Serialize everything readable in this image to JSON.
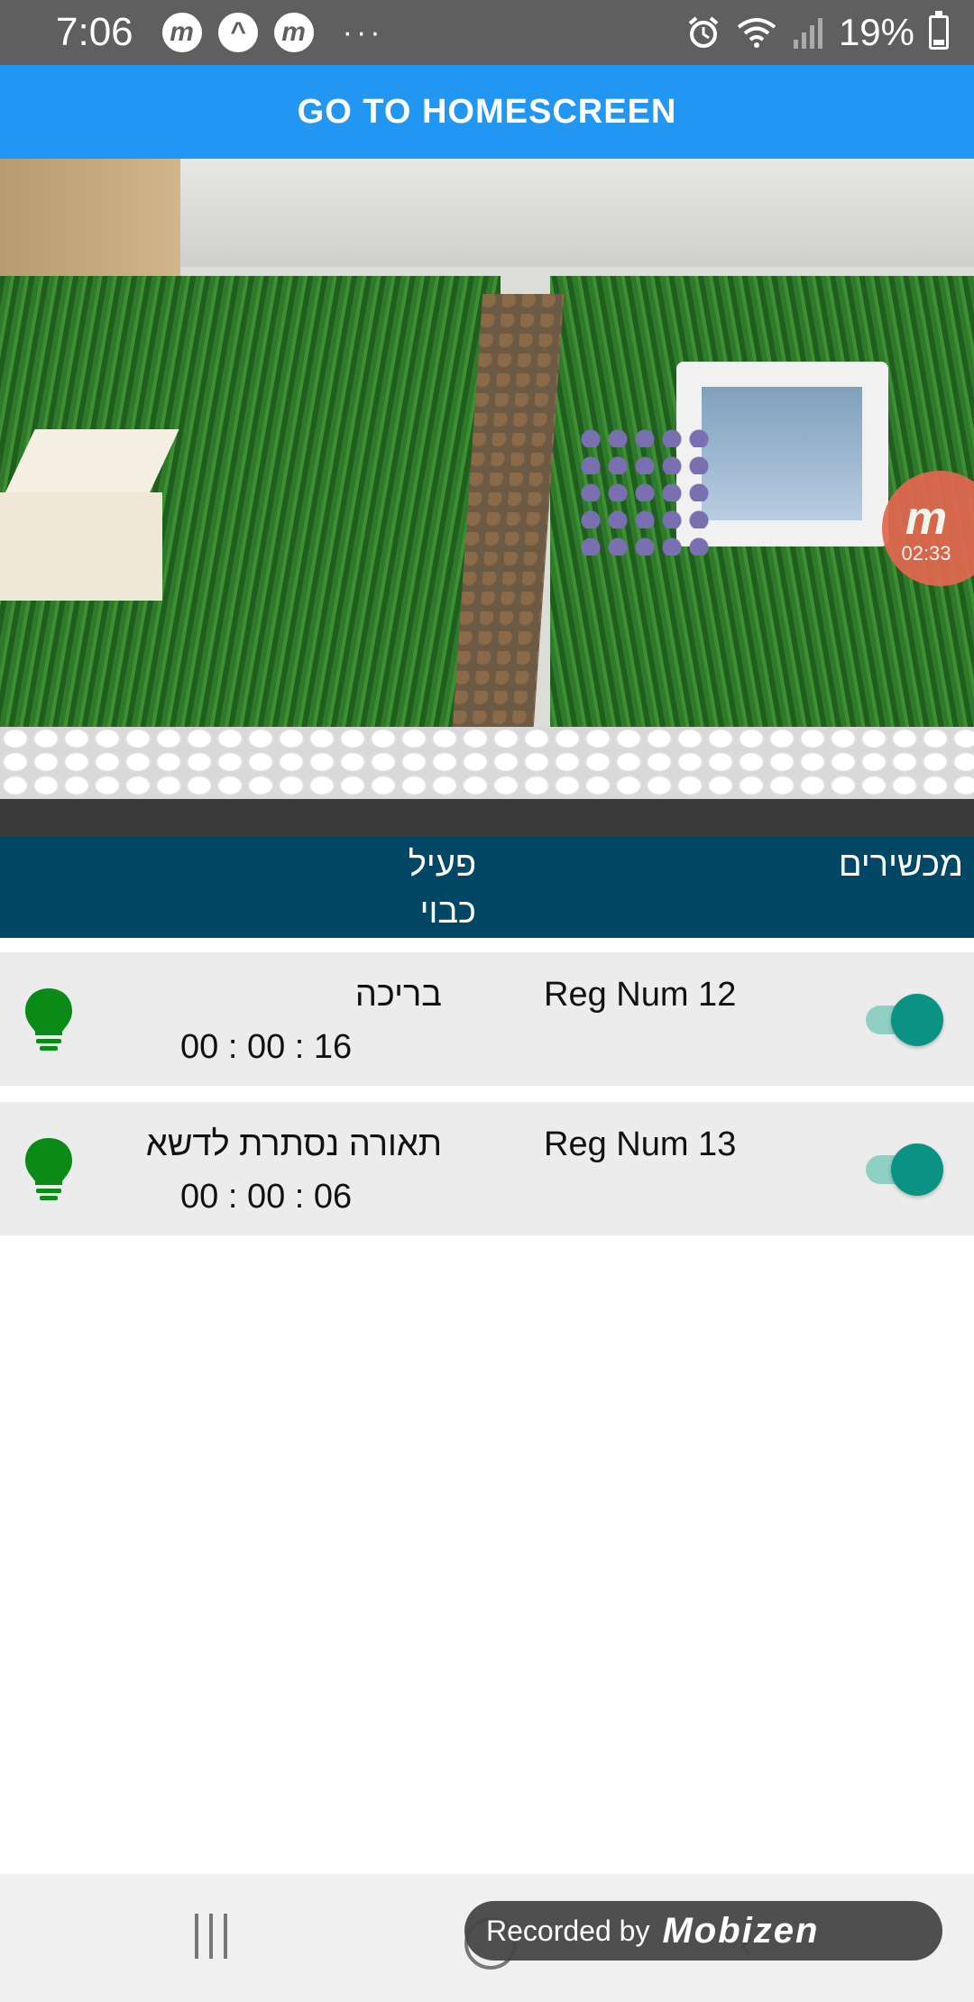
{
  "status_bar": {
    "time": "7:06",
    "badges": [
      "m",
      "^",
      "m"
    ],
    "overflow": "···",
    "battery": "19%",
    "icons": [
      "alarm-icon",
      "wifi-icon",
      "signal-icon",
      "battery-icon"
    ]
  },
  "header": {
    "button_label": "GO TO HOMESCREEN"
  },
  "camera": {
    "recorder_logo": "m",
    "recorder_time": "02:33"
  },
  "table_header": {
    "devices": "מכשירים",
    "active": "פעיל",
    "off": "כבוי"
  },
  "devices": [
    {
      "reg": "Reg Num 12",
      "name": "בריכה",
      "time": "00 : 00 : 16",
      "on": true
    },
    {
      "reg": "Reg Num 13",
      "name": "תאורה נסתרת לדשא",
      "time": "00 : 00 : 06",
      "on": true
    }
  ],
  "overlay": {
    "recorded_by": "Recorded by",
    "brand": "Mobizen"
  },
  "colors": {
    "header_blue": "#2196f3",
    "table_header": "#024866",
    "toggle_on": "#0a9384",
    "bulb_green": "#0a8a16"
  }
}
